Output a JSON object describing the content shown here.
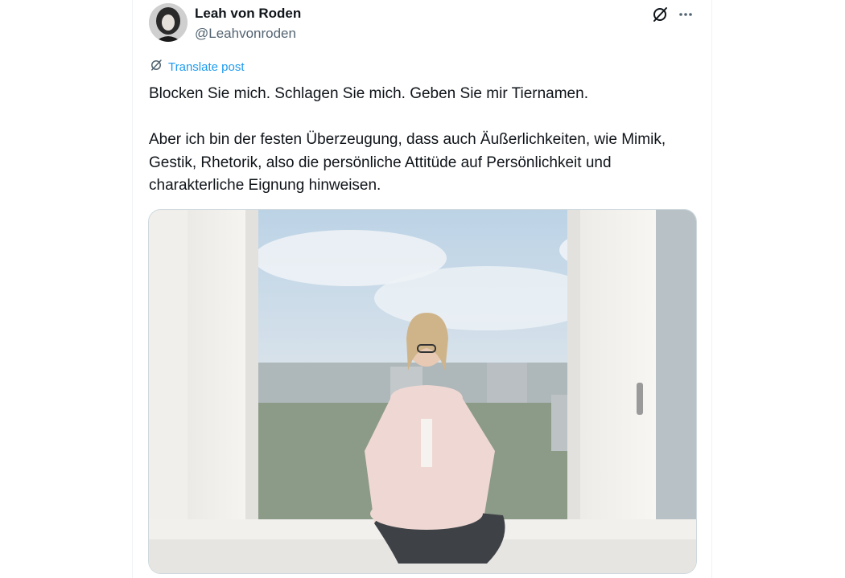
{
  "author": {
    "name": "Leah von Roden",
    "handle": "@Leahvonroden"
  },
  "header_icons": {
    "grok": "grok-slash-icon",
    "more": "more-dots-icon"
  },
  "translate": {
    "label": "Translate post",
    "color": "#1d9bf0"
  },
  "post": {
    "line1": "Blocken Sie mich. Schlagen Sie mich. Geben Sie mir Tiernamen.",
    "paragraph2": "Aber ich bin der festen Überzeugung, dass auch Äußerlichkeiten, wie Mimik, Gestik, Rhetorik, also die persönliche Attitüde auf Persönlichkeit und charakterliche Eignung hinweisen."
  },
  "colors": {
    "text": "#0f1419",
    "secondary": "#536471",
    "border": "#cfd9de"
  }
}
